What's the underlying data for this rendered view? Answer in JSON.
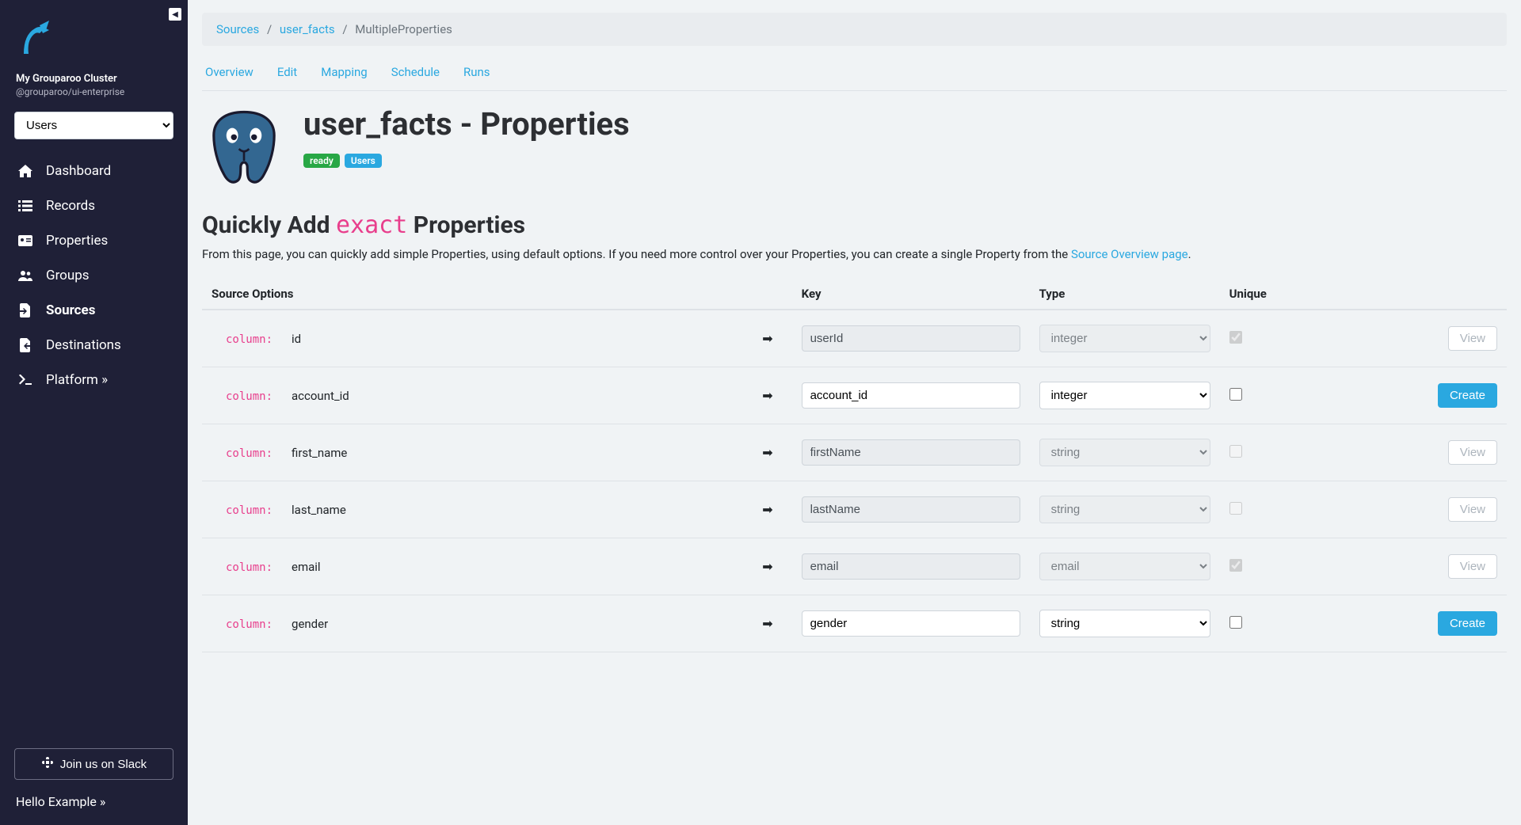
{
  "sidebar": {
    "cluster_name": "My Grouparoo Cluster",
    "cluster_sub": "@grouparoo/ui-enterprise",
    "model_selected": "Users",
    "nav": [
      {
        "icon": "home",
        "label": "Dashboard"
      },
      {
        "icon": "list",
        "label": "Records"
      },
      {
        "icon": "id-card",
        "label": "Properties"
      },
      {
        "icon": "users",
        "label": "Groups"
      },
      {
        "icon": "file-import",
        "label": "Sources",
        "active": true
      },
      {
        "icon": "file-export",
        "label": "Destinations"
      },
      {
        "icon": "terminal",
        "label": "Platform »"
      }
    ],
    "slack_label": "Join us on Slack",
    "hello": "Hello Example »"
  },
  "breadcrumb": {
    "items": [
      "Sources",
      "user_facts",
      "MultipleProperties"
    ]
  },
  "tabs": [
    "Overview",
    "Edit",
    "Mapping",
    "Schedule",
    "Runs"
  ],
  "header": {
    "title": "user_facts - Properties",
    "badges": {
      "ready": "ready",
      "users": "Users"
    }
  },
  "section": {
    "title_prefix": "Quickly Add ",
    "title_code": "exact",
    "title_suffix": " Properties",
    "desc_a": "From this page, you can quickly add simple Properties, using default options. If you need more control over your Properties, you can create a single Property from the ",
    "desc_link": "Source Overview page",
    "desc_b": "."
  },
  "table": {
    "headers": {
      "src": "Source Options",
      "key": "Key",
      "type": "Type",
      "unique": "Unique"
    },
    "col_label": "column:",
    "view_label": "View",
    "create_label": "Create",
    "rows": [
      {
        "col": "id",
        "key": "userId",
        "type": "integer",
        "unique": true,
        "disabled": true,
        "action": "view"
      },
      {
        "col": "account_id",
        "key": "account_id",
        "type": "integer",
        "unique": false,
        "disabled": false,
        "action": "create"
      },
      {
        "col": "first_name",
        "key": "firstName",
        "type": "string",
        "unique": false,
        "disabled": true,
        "action": "view"
      },
      {
        "col": "last_name",
        "key": "lastName",
        "type": "string",
        "unique": false,
        "disabled": true,
        "action": "view"
      },
      {
        "col": "email",
        "key": "email",
        "type": "email",
        "unique": true,
        "disabled": true,
        "action": "view"
      },
      {
        "col": "gender",
        "key": "gender",
        "type": "string",
        "unique": false,
        "disabled": false,
        "action": "create"
      }
    ]
  }
}
